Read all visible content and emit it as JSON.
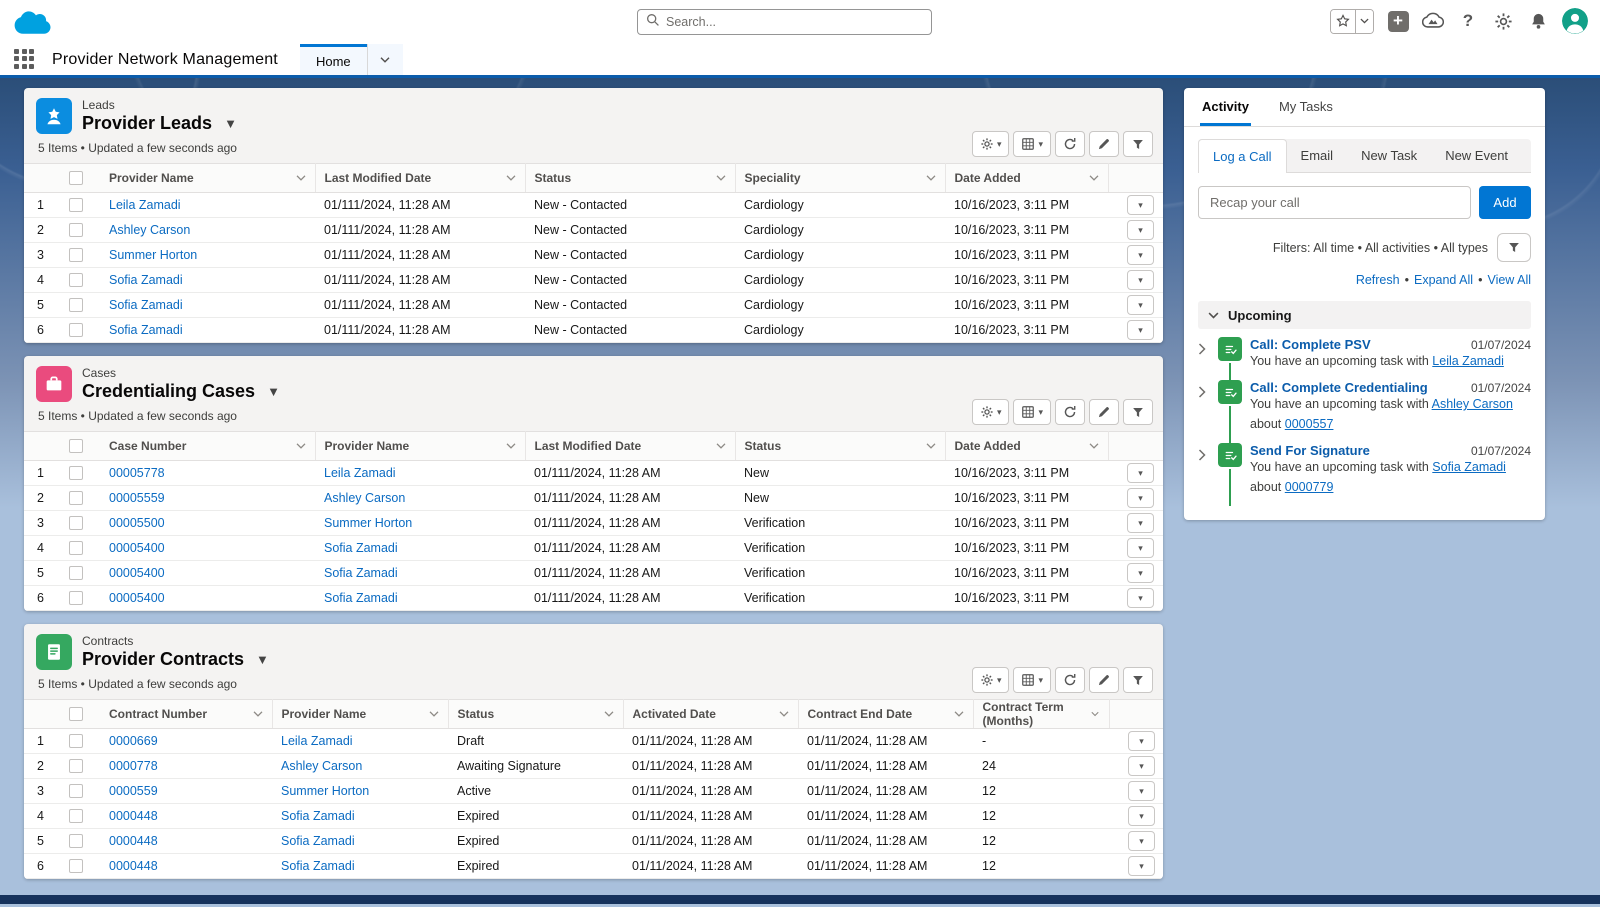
{
  "header": {
    "search_placeholder": "Search...",
    "app_name": "Provider Network Management",
    "home_tab_label": "Home"
  },
  "lists": [
    {
      "entity_label": "Leads",
      "title": "Provider Leads",
      "meta": "5 Items • Updated a few seconds ago",
      "columns": [
        "Provider Name",
        "Last Modified Date",
        "Status",
        "Speciality",
        "Date Added"
      ],
      "link_columns": [
        0
      ],
      "rows": [
        [
          "Leila Zamadi",
          "01/111/2024, 11:28 AM",
          "New - Contacted",
          "Cardiology",
          "10/16/2023, 3:11 PM"
        ],
        [
          "Ashley Carson",
          "01/111/2024, 11:28 AM",
          "New - Contacted",
          "Cardiology",
          "10/16/2023, 3:11 PM"
        ],
        [
          "Summer Horton",
          "01/111/2024, 11:28 AM",
          "New - Contacted",
          "Cardiology",
          "10/16/2023, 3:11 PM"
        ],
        [
          "Sofia Zamadi",
          "01/111/2024, 11:28 AM",
          "New - Contacted",
          "Cardiology",
          "10/16/2023, 3:11 PM"
        ],
        [
          "Sofia Zamadi",
          "01/111/2024, 11:28 AM",
          "New - Contacted",
          "Cardiology",
          "10/16/2023, 3:11 PM"
        ],
        [
          "Sofia Zamadi",
          "01/111/2024, 11:28 AM",
          "New - Contacted",
          "Cardiology",
          "10/16/2023, 3:11 PM"
        ]
      ]
    },
    {
      "entity_label": "Cases",
      "title": "Credentialing Cases",
      "meta": "5 Items • Updated a few seconds ago",
      "columns": [
        "Case Number",
        "Provider Name",
        "Last Modified Date",
        "Status",
        "Date Added"
      ],
      "link_columns": [
        0,
        1
      ],
      "rows": [
        [
          "00005778",
          "Leila Zamadi",
          "01/111/2024, 11:28 AM",
          "New",
          "10/16/2023, 3:11 PM"
        ],
        [
          "00005559",
          "Ashley Carson",
          "01/111/2024, 11:28 AM",
          "New",
          "10/16/2023, 3:11 PM"
        ],
        [
          "00005500",
          "Summer Horton",
          "01/111/2024, 11:28 AM",
          "Verification",
          "10/16/2023, 3:11 PM"
        ],
        [
          "00005400",
          "Sofia Zamadi",
          "01/111/2024, 11:28 AM",
          "Verification",
          "10/16/2023, 3:11 PM"
        ],
        [
          "00005400",
          "Sofia Zamadi",
          "01/111/2024, 11:28 AM",
          "Verification",
          "10/16/2023, 3:11 PM"
        ],
        [
          "00005400",
          "Sofia Zamadi",
          "01/111/2024, 11:28 AM",
          "Verification",
          "10/16/2023, 3:11 PM"
        ]
      ]
    },
    {
      "entity_label": "Contracts",
      "title": "Provider Contracts",
      "meta": "5 Items • Updated a few seconds ago",
      "columns": [
        "Contract Number",
        "Provider Name",
        "Status",
        "Activated Date",
        "Contract End Date",
        "Contract Term (Months)"
      ],
      "link_columns": [
        0,
        1
      ],
      "rows": [
        [
          "0000669",
          "Leila Zamadi",
          "Draft",
          "01/11/2024, 11:28 AM",
          "01/11/2024, 11:28 AM",
          "-"
        ],
        [
          "0000778",
          "Ashley Carson",
          "Awaiting Signature",
          "01/11/2024, 11:28 AM",
          "01/11/2024, 11:28 AM",
          "24"
        ],
        [
          "0000559",
          "Summer Horton",
          "Active",
          "01/11/2024, 11:28 AM",
          "01/11/2024, 11:28 AM",
          "12"
        ],
        [
          "0000448",
          "Sofia Zamadi",
          "Expired",
          "01/11/2024, 11:28 AM",
          "01/11/2024, 11:28 AM",
          "12"
        ],
        [
          "0000448",
          "Sofia Zamadi",
          "Expired",
          "01/11/2024, 11:28 AM",
          "01/11/2024, 11:28 AM",
          "12"
        ],
        [
          "0000448",
          "Sofia Zamadi",
          "Expired",
          "01/11/2024, 11:28 AM",
          "01/11/2024, 11:28 AM",
          "12"
        ]
      ]
    }
  ],
  "activity": {
    "tabs": [
      {
        "label": "Activity",
        "active": true
      },
      {
        "label": "My Tasks",
        "active": false
      }
    ],
    "composer_tabs": [
      {
        "label": "Log a Call",
        "active": true
      },
      {
        "label": "Email",
        "active": false
      },
      {
        "label": "New Task",
        "active": false
      },
      {
        "label": "New Event",
        "active": false
      }
    ],
    "recap_placeholder": "Recap your call",
    "add_button": "Add",
    "filters_text": "Filters: All time • All activities • All types",
    "action_links": [
      "Refresh",
      "Expand All",
      "View All"
    ],
    "section_title": "Upcoming",
    "items": [
      {
        "title": "Call: Complete PSV",
        "date": "01/07/2024",
        "body": [
          {
            "text": "You have an upcoming task with ",
            "link": false
          },
          {
            "text": "Leila Zamadi",
            "link": true
          }
        ]
      },
      {
        "title": "Call: Complete Credentialing",
        "date": "01/07/2024",
        "body": [
          {
            "text": "You have an upcoming task with ",
            "link": false
          },
          {
            "text": "Ashley Carson",
            "link": true
          },
          {
            "text": " about ",
            "link": false
          },
          {
            "text": "0000557",
            "link": true
          }
        ]
      },
      {
        "title": "Send For Signature",
        "date": "01/07/2024",
        "body": [
          {
            "text": "You have an upcoming task with ",
            "link": false
          },
          {
            "text": "Sofia Zamadi",
            "link": true
          },
          {
            "text": " about ",
            "link": false
          },
          {
            "text": "0000779",
            "link": true
          }
        ]
      }
    ]
  },
  "colors": {
    "brand_accent": "#0176d3",
    "nav_border": "#0b5cab",
    "leads_icon": "#0b8de0",
    "cases_icon": "#ea4b7e",
    "contracts_icon": "#35a860",
    "task_icon": "#2e9f50",
    "avatar": "#12a088",
    "logo_blue": "#00a1e0"
  }
}
